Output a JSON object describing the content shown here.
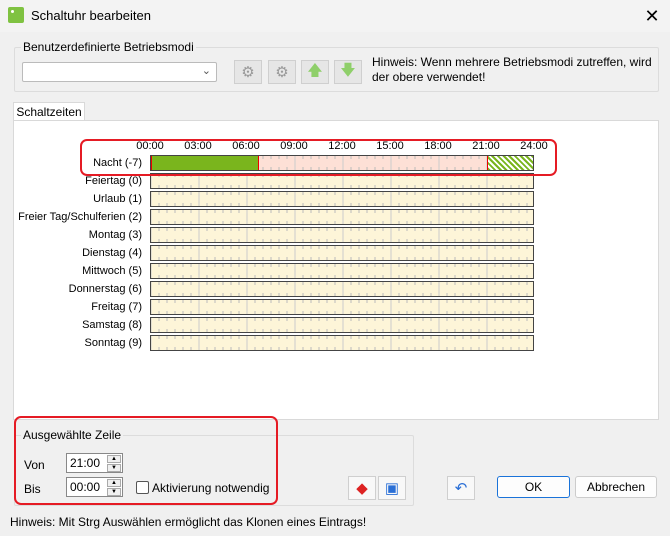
{
  "window": {
    "title": "Schaltuhr bearbeiten"
  },
  "modes": {
    "legend": "Benutzerdefinierte Betriebsmodi",
    "selected": "",
    "hint": "Hinweis: Wenn mehrere Betriebsmodi zutreffen, wird der obere verwendet!"
  },
  "tabs": [
    {
      "label": "Schaltzeiten"
    }
  ],
  "timeline": {
    "hours": [
      "00:00",
      "03:00",
      "06:00",
      "09:00",
      "12:00",
      "15:00",
      "18:00",
      "21:00",
      "24:00"
    ],
    "colors": {
      "active": "#7ab51d",
      "empty": "#fdf5d8",
      "selected_bg": "#fde0d6"
    },
    "rows": [
      {
        "label": "Nacht (-7)",
        "selected": true,
        "segments": [
          {
            "start": 0,
            "end": 6.75,
            "type": "active"
          },
          {
            "start": 21,
            "end": 24,
            "type": "hatched"
          }
        ]
      },
      {
        "label": "Feiertag (0)",
        "segments": []
      },
      {
        "label": "Urlaub (1)",
        "segments": []
      },
      {
        "label": "Freier Tag/Schulferien (2)",
        "segments": []
      },
      {
        "label": "Montag (3)",
        "segments": []
      },
      {
        "label": "Dienstag (4)",
        "segments": []
      },
      {
        "label": "Mittwoch (5)",
        "segments": []
      },
      {
        "label": "Donnerstag (6)",
        "segments": []
      },
      {
        "label": "Freitag (7)",
        "segments": []
      },
      {
        "label": "Samstag (8)",
        "segments": []
      },
      {
        "label": "Sonntag (9)",
        "segments": []
      }
    ]
  },
  "selection": {
    "legend": "Ausgewählte Zeile",
    "von_label": "Von",
    "von": "21:00",
    "bis_label": "Bis",
    "bis": "00:00",
    "checkbox_label": "Aktivierung notwendig",
    "checked": false
  },
  "buttons": {
    "ok": "OK",
    "cancel": "Abbrechen"
  },
  "footer_hint": "Hinweis: Mit Strg Auswählen ermöglicht das Klonen eines Eintrags!"
}
